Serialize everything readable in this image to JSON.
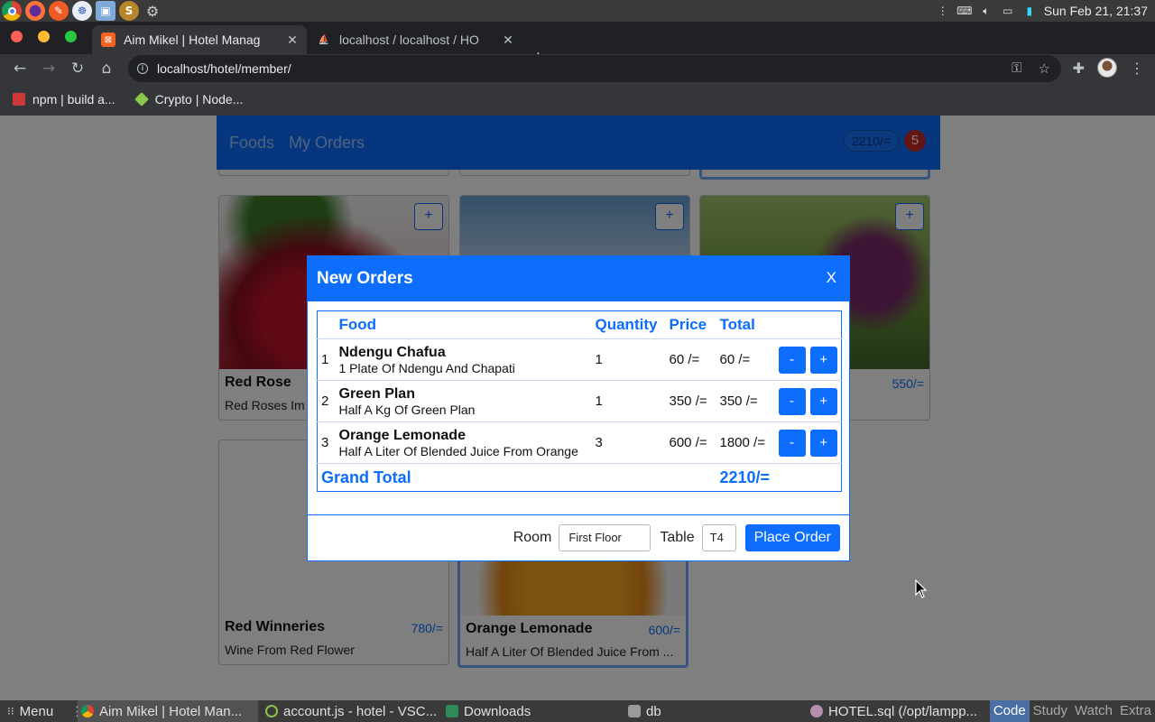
{
  "os": {
    "clock": "Sun Feb 21, 21:37"
  },
  "browser": {
    "tabs": [
      {
        "title": "Aim Mikel | Hotel Manag",
        "active": true,
        "icon": "hotel-favicon"
      },
      {
        "title": "localhost / localhost / HO",
        "active": false,
        "icon": "phpmyadmin-favicon"
      }
    ],
    "url": "localhost/hotel/member/",
    "bookmarks": [
      {
        "label": "npm | build a...",
        "icon": "npm-icon"
      },
      {
        "label": "Crypto | Node...",
        "icon": "nodejs-icon"
      }
    ]
  },
  "app": {
    "nav": {
      "links": [
        "Foods",
        "My Orders"
      ],
      "cart_total": "2210/=",
      "cart_count": "5"
    },
    "cards": [
      {
        "title": "Red Rose",
        "desc": "Red Roses Im",
        "price": ""
      },
      {
        "title": "",
        "desc": "",
        "price": ""
      },
      {
        "title": "",
        "desc": "",
        "price": "550/="
      },
      {
        "title": "Red Winneries",
        "desc": "Wine From Red Flower",
        "price": "780/="
      },
      {
        "title": "Orange Lemonade",
        "desc": "Half A Liter Of Blended Juice From ...",
        "price": "600/="
      }
    ],
    "add_label": "+"
  },
  "modal": {
    "title": "New Orders",
    "close": "X",
    "columns": [
      "",
      "Food",
      "Quantity",
      "Price",
      "Total",
      ""
    ],
    "rows": [
      {
        "num": "1",
        "name": "Ndengu Chafua",
        "desc": "1 Plate Of Ndengu And Chapati",
        "qty": "1",
        "price": "60 /=",
        "total": "60 /="
      },
      {
        "num": "2",
        "name": "Green Plan",
        "desc": "Half A Kg Of Green Plan",
        "qty": "1",
        "price": "350 /=",
        "total": "350 /="
      },
      {
        "num": "3",
        "name": "Orange Lemonade",
        "desc": "Half A Liter Of Blended Juice From Orange",
        "qty": "3",
        "price": "600 /=",
        "total": "1800 /="
      }
    ],
    "minus": "-",
    "plus": "+",
    "grand_total_label": "Grand Total",
    "grand_total_value": "2210/=",
    "room_label": "Room",
    "room_value": "First Floor",
    "table_label": "Table",
    "table_value": "T4",
    "place_order": "Place Order"
  },
  "taskbar": {
    "menu": "Menu",
    "items": [
      {
        "label": "Aim Mikel | Hotel Man...",
        "icon": "chrome-icon",
        "active": true
      },
      {
        "label": "account.js - hotel - VSC...",
        "icon": "vscode-icon",
        "active": false
      },
      {
        "label": "Downloads",
        "icon": "folder-icon",
        "active": false
      },
      {
        "label": "db",
        "icon": "folder-icon",
        "active": false
      },
      {
        "label": "HOTEL.sql (/opt/lampp...",
        "icon": "editor-icon",
        "active": false
      }
    ],
    "workspaces": [
      "Code",
      "Study",
      "Watch",
      "Extra"
    ]
  }
}
